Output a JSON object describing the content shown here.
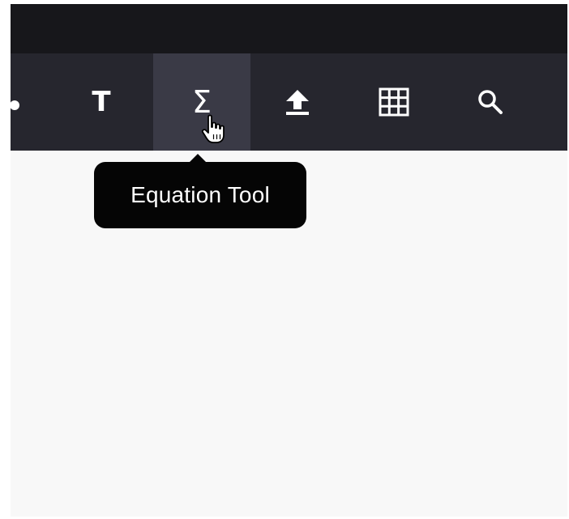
{
  "toolbar": {
    "tools": [
      {
        "id": "shapes",
        "icon": "shapes-icon",
        "active": false,
        "partially_visible": true
      },
      {
        "id": "text",
        "glyph": "T",
        "icon": "text-icon",
        "active": false
      },
      {
        "id": "equation",
        "glyph": "Σ",
        "icon": "sigma-icon",
        "active": true
      },
      {
        "id": "upload",
        "icon": "upload-icon",
        "active": false
      },
      {
        "id": "table",
        "icon": "table-icon",
        "active": false
      },
      {
        "id": "search",
        "icon": "search-icon",
        "active": false
      }
    ]
  },
  "tooltip": {
    "label": "Equation Tool"
  },
  "cursor": {
    "icon": "pointer-hand-icon"
  },
  "colors": {
    "titlebar": "#17171b",
    "toolbar": "#26262e",
    "toolbar_active": "#3a3a46",
    "tooltip_background": "#050505",
    "canvas": "#f8f8f8",
    "icon": "#ffffff"
  }
}
